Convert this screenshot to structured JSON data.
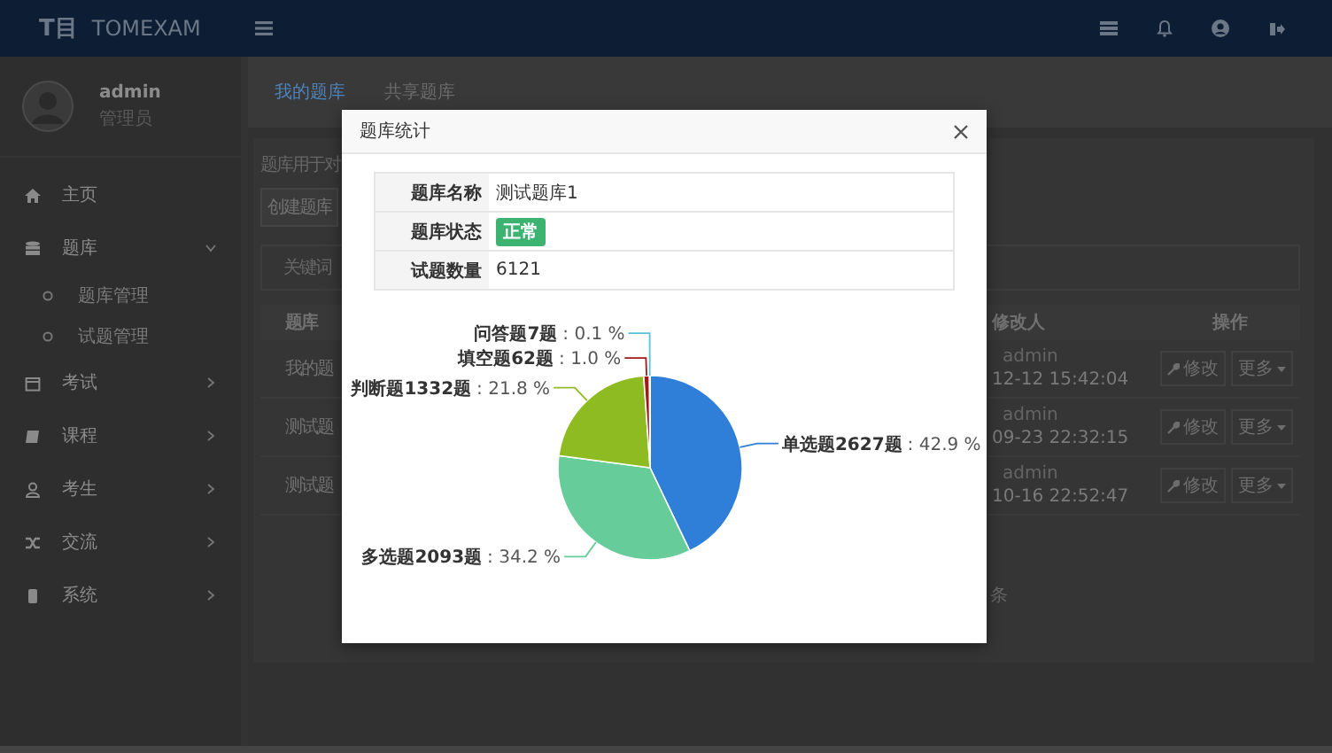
{
  "topbar": {
    "logo_mark": "T目",
    "brand": "TOMEXAM"
  },
  "user": {
    "name": "admin",
    "role": "管理员"
  },
  "menu": [
    {
      "label": "主页"
    },
    {
      "label": "题库",
      "expanded": true,
      "children": [
        {
          "label": "题库管理"
        },
        {
          "label": "试题管理"
        }
      ]
    },
    {
      "label": "考试",
      "expanded": false
    },
    {
      "label": "课程",
      "expanded": false
    },
    {
      "label": "考生",
      "expanded": false
    },
    {
      "label": "交流",
      "expanded": false
    },
    {
      "label": "系统",
      "expanded": false
    }
  ],
  "tabs": [
    {
      "label": "我的题库",
      "selected": true
    },
    {
      "label": "共享题库",
      "selected": false
    }
  ],
  "description": "题库用于对",
  "create_button": "创建题库",
  "search_label": "关键词",
  "table": {
    "columns": [
      "题库",
      "修改人",
      "操作"
    ],
    "rows": [
      {
        "name": "我的题",
        "modifier": "admin",
        "time": "12-12 15:42:04",
        "actions": [
          "修改",
          "更多"
        ]
      },
      {
        "name": "测试题",
        "modifier": "admin",
        "time": "09-23 22:32:15",
        "actions": [
          "修改",
          "更多"
        ]
      },
      {
        "name": "测试题",
        "modifier": "admin",
        "time": "10-16 22:52:47",
        "actions": [
          "修改",
          "更多"
        ]
      }
    ]
  },
  "pagination": {
    "unit": "条"
  },
  "modal": {
    "title": "题库统计",
    "info": [
      {
        "label": "题库名称",
        "value": "测试题库1",
        "kind": "text"
      },
      {
        "label": "题库状态",
        "value": "正常",
        "kind": "badge"
      },
      {
        "label": "试题数量",
        "value": "6121",
        "kind": "text"
      }
    ],
    "chart_data": {
      "type": "pie",
      "categories": [
        "单选题2627题",
        "多选题2093题",
        "判断题1332题",
        "填空题62题",
        "问答题7题"
      ],
      "values": [
        42.9,
        34.2,
        21.8,
        1.0,
        0.1
      ],
      "value_labels": [
        ": 42.9 %",
        ": 34.2 %",
        ": 21.8 %",
        ": 1.0 %",
        ": 0.1 %"
      ],
      "colors": [
        "#2f7ed8",
        "#66cc99",
        "#8fbb22",
        "#a01818",
        "#5bc0de"
      ]
    }
  }
}
